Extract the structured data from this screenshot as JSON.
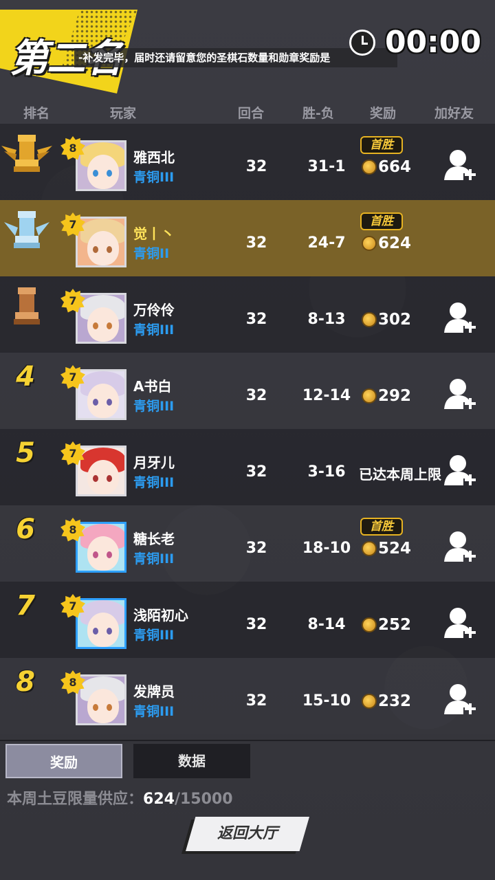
{
  "header": {
    "rank_title": "第二名",
    "notice": "-补发完毕，届时还请留意您的圣棋石数量和勋章奖励是",
    "timer": "00:00"
  },
  "columns": {
    "rank": "排名",
    "player": "玩家",
    "rounds": "回合",
    "win_loss": "胜-负",
    "reward": "奖励",
    "add_friend": "加好友"
  },
  "rows": [
    {
      "rank": "1",
      "level": "8",
      "name": "雅西北",
      "tier": "青铜III",
      "rounds": "32",
      "wl": "31-1",
      "first_win": "首胜",
      "reward": "664",
      "limit": ""
    },
    {
      "rank": "2",
      "level": "7",
      "name": "觉丨丶",
      "tier": "青铜II",
      "rounds": "32",
      "wl": "24-7",
      "first_win": "首胜",
      "reward": "624",
      "limit": ""
    },
    {
      "rank": "3",
      "level": "7",
      "name": "万伶伶",
      "tier": "青铜III",
      "rounds": "32",
      "wl": "8-13",
      "first_win": "",
      "reward": "302",
      "limit": ""
    },
    {
      "rank": "4",
      "level": "7",
      "name": "A书白",
      "tier": "青铜III",
      "rounds": "32",
      "wl": "12-14",
      "first_win": "",
      "reward": "292",
      "limit": ""
    },
    {
      "rank": "5",
      "level": "7",
      "name": "月牙儿",
      "tier": "青铜III",
      "rounds": "32",
      "wl": "3-16",
      "first_win": "",
      "reward": "",
      "limit": "已达本周上限"
    },
    {
      "rank": "6",
      "level": "8",
      "name": "糖长老",
      "tier": "青铜III",
      "rounds": "32",
      "wl": "18-10",
      "first_win": "首胜",
      "reward": "524",
      "limit": ""
    },
    {
      "rank": "7",
      "level": "7",
      "name": "浅陌初心",
      "tier": "青铜III",
      "rounds": "32",
      "wl": "8-14",
      "first_win": "",
      "reward": "252",
      "limit": ""
    },
    {
      "rank": "8",
      "level": "8",
      "name": "发牌员",
      "tier": "青铜III",
      "rounds": "32",
      "wl": "15-10",
      "first_win": "",
      "reward": "232",
      "limit": ""
    }
  ],
  "tabs": {
    "reward": "奖励",
    "data": "数据"
  },
  "supply": {
    "label": "本周土豆限量供应：",
    "current": "624",
    "total": "/15000"
  },
  "back_button": "返回大厅",
  "colors": {
    "accent_yellow": "#f2d41b",
    "tier_blue": "#2c9cf0",
    "highlight_row": "#7a6228"
  }
}
